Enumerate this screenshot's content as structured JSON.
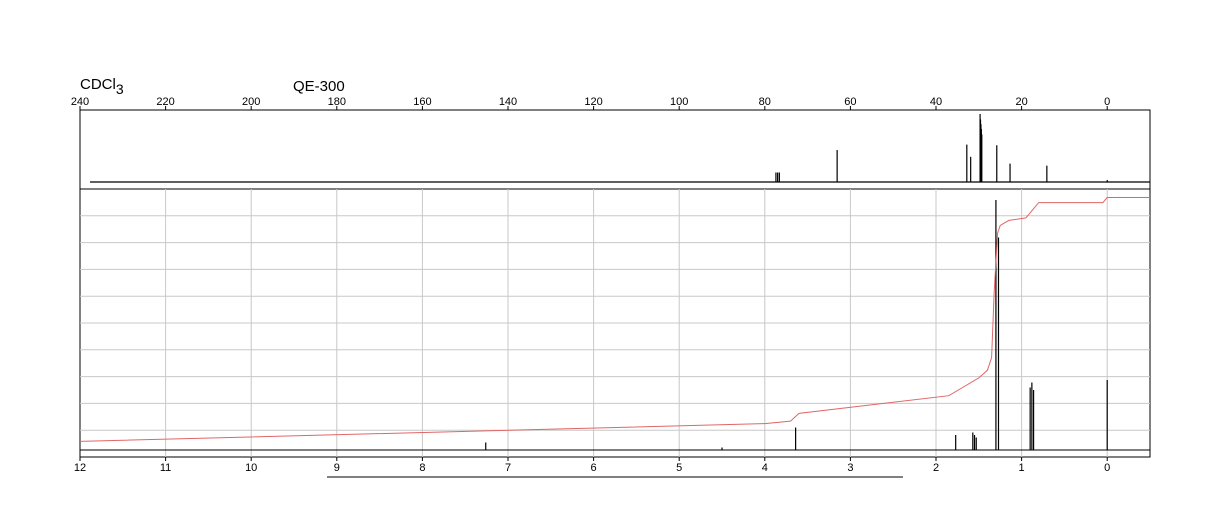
{
  "header": {
    "solvent": "CDCl",
    "solvent_subscript": "3",
    "instrument": "QE-300"
  },
  "chart_data": [
    {
      "type": "line",
      "title": "",
      "xlabel": "",
      "ylabel": "",
      "x_ticks": [
        240,
        220,
        200,
        180,
        160,
        140,
        120,
        100,
        80,
        60,
        40,
        20,
        0
      ],
      "xlim": [
        240,
        -10
      ],
      "x_reversed": true,
      "grid": false,
      "series": [
        {
          "kind": "peaks",
          "color": "#000000",
          "x": [
            77.4,
            77.0,
            76.6,
            63.1,
            32.8,
            31.9,
            29.7,
            29.6,
            29.5,
            29.4,
            29.3,
            25.8,
            22.7,
            14.1,
            0.0
          ],
          "y": [
            0.14,
            0.14,
            0.14,
            0.47,
            0.55,
            0.37,
            1.0,
            0.92,
            0.85,
            0.78,
            0.7,
            0.54,
            0.27,
            0.24,
            0.03
          ]
        }
      ]
    },
    {
      "type": "line",
      "title": "",
      "xlabel": "",
      "ylabel": "",
      "x_ticks": [
        12,
        11,
        10,
        9,
        8,
        7,
        6,
        5,
        4,
        3,
        2,
        1,
        0
      ],
      "xlim": [
        12,
        -0.5
      ],
      "x_reversed": true,
      "grid": true,
      "series": [
        {
          "kind": "peaks",
          "color": "#000000",
          "x": [
            7.26,
            4.5,
            3.64,
            1.77,
            1.57,
            1.55,
            1.53,
            1.3,
            1.27,
            0.9,
            0.88,
            0.86,
            0.0
          ],
          "y": [
            0.03,
            0.01,
            0.09,
            0.06,
            0.07,
            0.06,
            0.05,
            1.0,
            0.85,
            0.25,
            0.27,
            0.24,
            0.28
          ]
        },
        {
          "kind": "integral",
          "color": "#e06666",
          "x": [
            12.0,
            4.0,
            3.7,
            3.6,
            1.85,
            1.7,
            1.5,
            1.4,
            1.35,
            1.32,
            1.28,
            1.25,
            1.15,
            0.95,
            0.85,
            0.8,
            0.05,
            0.0,
            -0.5
          ],
          "y": [
            0.03,
            0.1,
            0.11,
            0.14,
            0.21,
            0.24,
            0.28,
            0.31,
            0.36,
            0.62,
            0.85,
            0.88,
            0.9,
            0.91,
            0.95,
            0.97,
            0.97,
            0.99,
            0.99
          ]
        }
      ]
    }
  ]
}
